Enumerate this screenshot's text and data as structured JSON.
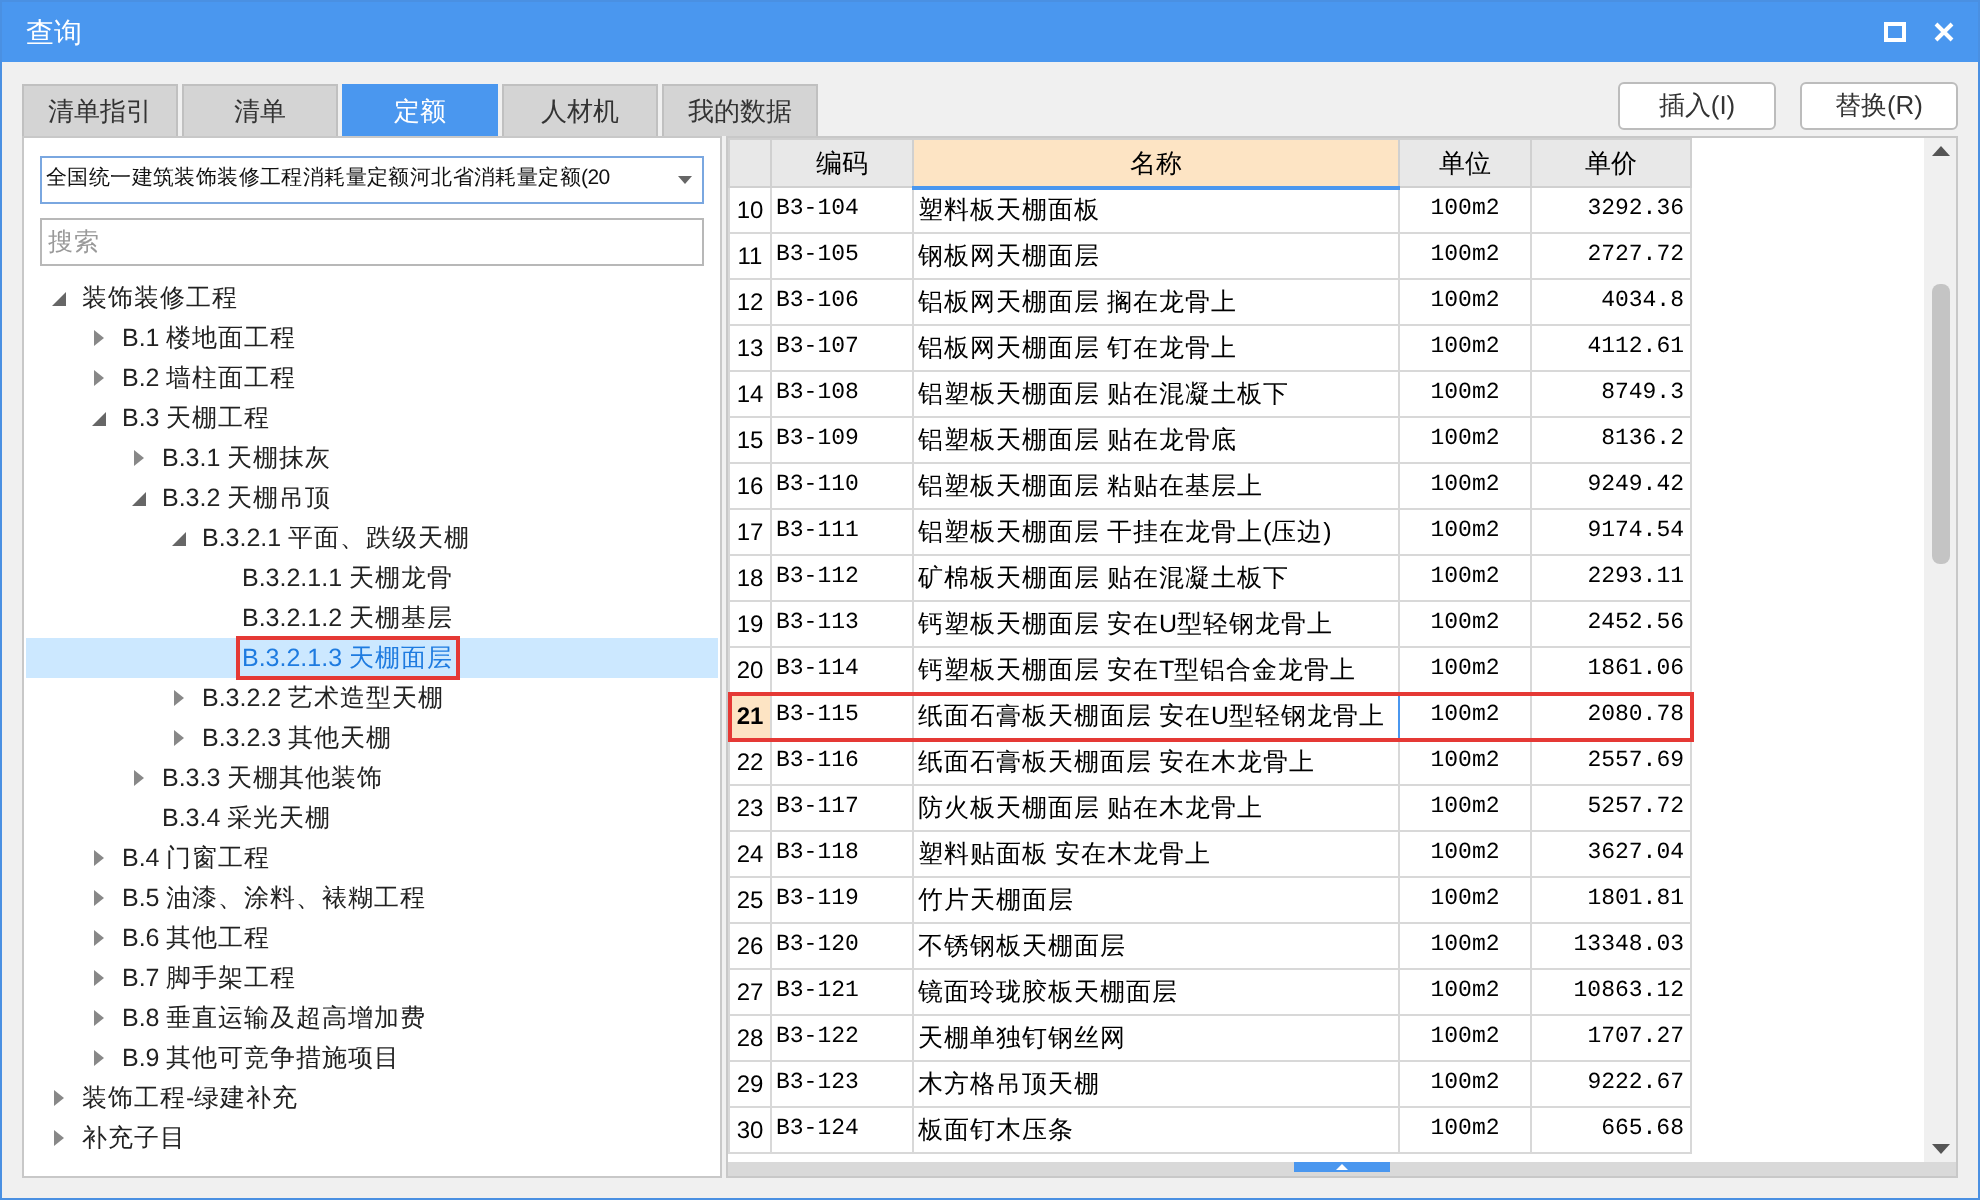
{
  "window": {
    "title": "查询"
  },
  "tabs": [
    {
      "label": "清单指引",
      "selected": false
    },
    {
      "label": "清单",
      "selected": false
    },
    {
      "label": "定额",
      "selected": true
    },
    {
      "label": "人材机",
      "selected": false
    },
    {
      "label": "我的数据",
      "selected": false
    }
  ],
  "buttons": [
    "插入(I)",
    "替换(R)"
  ],
  "library_select": {
    "value": "全国统一建筑装饰装修工程消耗量定额河北省消耗量定额(20"
  },
  "search": {
    "placeholder": "搜索"
  },
  "tree": [
    {
      "label": "装饰装修工程",
      "kind": "branch",
      "expanded": true,
      "selected": false,
      "marked": false,
      "children": [
        {
          "label": "B.1 楼地面工程",
          "kind": "branch",
          "expanded": false,
          "selected": false,
          "marked": false
        },
        {
          "label": "B.2 墙柱面工程",
          "kind": "branch",
          "expanded": false,
          "selected": false,
          "marked": false
        },
        {
          "label": "B.3 天棚工程",
          "kind": "branch",
          "expanded": true,
          "selected": false,
          "marked": false,
          "children": [
            {
              "label": "B.3.1 天棚抹灰",
              "kind": "branch",
              "expanded": false,
              "selected": false,
              "marked": false
            },
            {
              "label": "B.3.2 天棚吊顶",
              "kind": "branch",
              "expanded": true,
              "selected": false,
              "marked": false,
              "children": [
                {
                  "label": "B.3.2.1 平面、跌级天棚",
                  "kind": "branch",
                  "expanded": true,
                  "selected": false,
                  "marked": false,
                  "children": [
                    {
                      "label": "B.3.2.1.1 天棚龙骨",
                      "kind": "leaf",
                      "selected": false,
                      "marked": false
                    },
                    {
                      "label": "B.3.2.1.2 天棚基层",
                      "kind": "leaf",
                      "selected": false,
                      "marked": false
                    },
                    {
                      "label": "B.3.2.1.3 天棚面层",
                      "kind": "leaf",
                      "selected": true,
                      "marked": true
                    }
                  ]
                },
                {
                  "label": "B.3.2.2 艺术造型天棚",
                  "kind": "branch",
                  "expanded": false,
                  "selected": false,
                  "marked": false
                },
                {
                  "label": "B.3.2.3 其他天棚",
                  "kind": "branch",
                  "expanded": false,
                  "selected": false,
                  "marked": false
                }
              ]
            },
            {
              "label": "B.3.3 天棚其他装饰",
              "kind": "branch",
              "expanded": false,
              "selected": false,
              "marked": false
            },
            {
              "label": "B.3.4 采光天棚",
              "kind": "leaf",
              "selected": false,
              "marked": false
            }
          ]
        },
        {
          "label": "B.4 门窗工程",
          "kind": "branch",
          "expanded": false,
          "selected": false,
          "marked": false
        },
        {
          "label": "B.5 油漆、涂料、裱糊工程",
          "kind": "branch",
          "expanded": false,
          "selected": false,
          "marked": false
        },
        {
          "label": "B.6 其他工程",
          "kind": "branch",
          "expanded": false,
          "selected": false,
          "marked": false
        },
        {
          "label": "B.7 脚手架工程",
          "kind": "branch",
          "expanded": false,
          "selected": false,
          "marked": false
        },
        {
          "label": "B.8 垂直运输及超高增加费",
          "kind": "branch",
          "expanded": false,
          "selected": false,
          "marked": false
        },
        {
          "label": "B.9 其他可竞争措施项目",
          "kind": "branch",
          "expanded": false,
          "selected": false,
          "marked": false
        }
      ]
    },
    {
      "label": "装饰工程-绿建补充",
      "kind": "branch",
      "expanded": false,
      "selected": false,
      "marked": false
    },
    {
      "label": "补充子目",
      "kind": "branch",
      "expanded": false,
      "selected": false,
      "marked": false
    }
  ],
  "table": {
    "columns": [
      {
        "label": "编码",
        "selected": false
      },
      {
        "label": "名称",
        "selected": true
      },
      {
        "label": "单位",
        "selected": false
      },
      {
        "label": "单价",
        "selected": false
      }
    ],
    "rows": [
      {
        "num": "10",
        "code": "B3-104",
        "name": "塑料板天棚面板",
        "unit": "100m2",
        "price": "3292.36",
        "selected": false,
        "marked": false
      },
      {
        "num": "11",
        "code": "B3-105",
        "name": "钢板网天棚面层",
        "unit": "100m2",
        "price": "2727.72",
        "selected": false,
        "marked": false
      },
      {
        "num": "12",
        "code": "B3-106",
        "name": "铝板网天棚面层 搁在龙骨上",
        "unit": "100m2",
        "price": "4034.8",
        "selected": false,
        "marked": false
      },
      {
        "num": "13",
        "code": "B3-107",
        "name": "铝板网天棚面层 钉在龙骨上",
        "unit": "100m2",
        "price": "4112.61",
        "selected": false,
        "marked": false
      },
      {
        "num": "14",
        "code": "B3-108",
        "name": "铝塑板天棚面层 贴在混凝土板下",
        "unit": "100m2",
        "price": "8749.3",
        "selected": false,
        "marked": false
      },
      {
        "num": "15",
        "code": "B3-109",
        "name": "铝塑板天棚面层 贴在龙骨底",
        "unit": "100m2",
        "price": "8136.2",
        "selected": false,
        "marked": false
      },
      {
        "num": "16",
        "code": "B3-110",
        "name": "铝塑板天棚面层 粘贴在基层上",
        "unit": "100m2",
        "price": "9249.42",
        "selected": false,
        "marked": false
      },
      {
        "num": "17",
        "code": "B3-111",
        "name": "铝塑板天棚面层 干挂在龙骨上(压边)",
        "unit": "100m2",
        "price": "9174.54",
        "selected": false,
        "marked": false
      },
      {
        "num": "18",
        "code": "B3-112",
        "name": "矿棉板天棚面层 贴在混凝土板下",
        "unit": "100m2",
        "price": "2293.11",
        "selected": false,
        "marked": false
      },
      {
        "num": "19",
        "code": "B3-113",
        "name": "钙塑板天棚面层 安在U型轻钢龙骨上",
        "unit": "100m2",
        "price": "2452.56",
        "selected": false,
        "marked": false
      },
      {
        "num": "20",
        "code": "B3-114",
        "name": "钙塑板天棚面层 安在T型铝合金龙骨上",
        "unit": "100m2",
        "price": "1861.06",
        "selected": false,
        "marked": false
      },
      {
        "num": "21",
        "code": "B3-115",
        "name": "纸面石膏板天棚面层 安在U型轻钢龙骨上",
        "unit": "100m2",
        "price": "2080.78",
        "selected": true,
        "marked": true
      },
      {
        "num": "22",
        "code": "B3-116",
        "name": "纸面石膏板天棚面层 安在木龙骨上",
        "unit": "100m2",
        "price": "2557.69",
        "selected": false,
        "marked": false
      },
      {
        "num": "23",
        "code": "B3-117",
        "name": "防火板天棚面层 贴在木龙骨上",
        "unit": "100m2",
        "price": "5257.72",
        "selected": false,
        "marked": false
      },
      {
        "num": "24",
        "code": "B3-118",
        "name": "塑料贴面板 安在木龙骨上",
        "unit": "100m2",
        "price": "3627.04",
        "selected": false,
        "marked": false
      },
      {
        "num": "25",
        "code": "B3-119",
        "name": "竹片天棚面层",
        "unit": "100m2",
        "price": "1801.81",
        "selected": false,
        "marked": false
      },
      {
        "num": "26",
        "code": "B3-120",
        "name": "不锈钢板天棚面层",
        "unit": "100m2",
        "price": "13348.03",
        "selected": false,
        "marked": false
      },
      {
        "num": "27",
        "code": "B3-121",
        "name": "镜面玲珑胶板天棚面层",
        "unit": "100m2",
        "price": "10863.12",
        "selected": false,
        "marked": false
      },
      {
        "num": "28",
        "code": "B3-122",
        "name": "天棚单独钉钢丝网",
        "unit": "100m2",
        "price": "1707.27",
        "selected": false,
        "marked": false
      },
      {
        "num": "29",
        "code": "B3-123",
        "name": "木方格吊顶天棚",
        "unit": "100m2",
        "price": "9222.67",
        "selected": false,
        "marked": false
      },
      {
        "num": "30",
        "code": "B3-124",
        "name": "板面钉木压条",
        "unit": "100m2",
        "price": "665.68",
        "selected": false,
        "marked": false
      }
    ]
  }
}
